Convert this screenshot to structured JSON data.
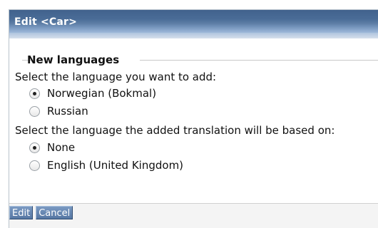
{
  "dialog": {
    "title": "Edit <Car>"
  },
  "new_languages": {
    "legend": "New languages",
    "prompt": "Select the language you want to add:",
    "options": [
      {
        "label": "Norwegian (Bokmal)",
        "checked": true
      },
      {
        "label": "Russian",
        "checked": false
      }
    ]
  },
  "base_translation": {
    "prompt": "Select the language the added translation will be based on:",
    "options": [
      {
        "label": "None",
        "checked": true
      },
      {
        "label": "English (United Kingdom)",
        "checked": false
      }
    ]
  },
  "footer": {
    "edit_label": "Edit",
    "cancel_label": "Cancel"
  }
}
